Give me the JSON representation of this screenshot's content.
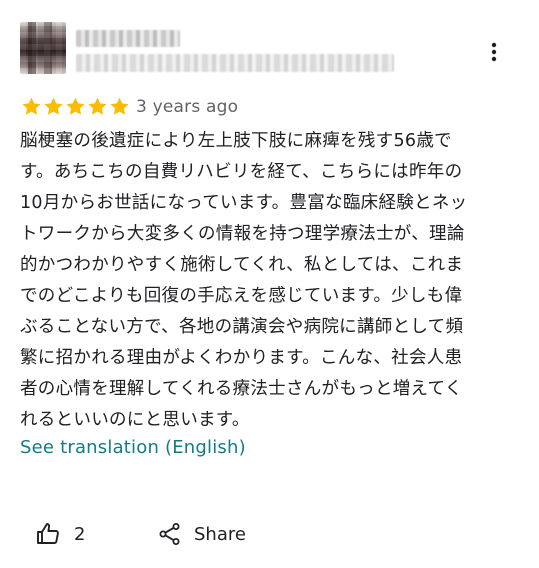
{
  "review": {
    "rating": 5,
    "rating_max": 5,
    "star_color": "#fbbc04",
    "time": "3 years ago",
    "text_lines": [
      "脳梗塞の後遺症により左上肢下肢に麻痺を残す56歳で",
      "す。あちこちの自費リハビリを経て、こちらには昨年の",
      "10月からお世話になっています。豊富な臨床経験とネッ",
      "トワークから大変多くの情報を持つ理学療法士が、理論",
      "的かつわかりやすく施術してくれ、私としては、これま",
      "でのどこよりも回復の手応えを感じています。少しも偉",
      "ぶることない方で、各地の講演会や病院に講師として頻",
      "繁に招かれる理由がよくわかります。こんな、社会人患",
      "者の心情を理解してくれる療法士さんがもっと増えてく",
      "れるといいのにと思います。"
    ],
    "translate_label": "See translation (English)",
    "link_color": "#137b87"
  },
  "actions": {
    "like_count": "2",
    "share_label": "Share"
  },
  "icons": {
    "menu": "more-vert-icon",
    "like": "thumb-up-icon",
    "share": "share-icon",
    "star": "star-icon"
  }
}
